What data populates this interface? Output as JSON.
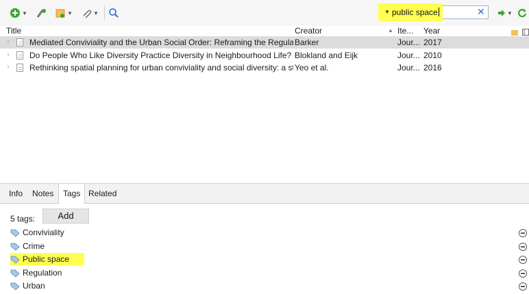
{
  "toolbar": {
    "icons": [
      "new-item-icon",
      "add-by-identifier-icon",
      "new-note-icon",
      "attach-icon",
      "advanced-search-icon",
      "locate-icon",
      "sync-icon"
    ],
    "colors": {
      "green": "#3aa53a",
      "orange": "#e8862a",
      "highlight": "#ffff52"
    }
  },
  "search": {
    "value": "public space",
    "clear_symbol": "✕"
  },
  "columns": {
    "title": "Title",
    "creator": "Creator",
    "item_type": "Ite...",
    "year": "Year"
  },
  "items": [
    {
      "title": "Mediated Conviviality and the Urban Social Order: Reframing the Regulation ...",
      "creator": "Barker",
      "type": "Jour...",
      "year": "2017"
    },
    {
      "title": "Do People Who Like Diversity Practice Diversity in Neighbourhood Life? Nei...",
      "creator": "Blokland and Eijk",
      "type": "Jour...",
      "year": "2010"
    },
    {
      "title": "Rethinking spatial planning for urban conviviality and social diversity: a study...",
      "creator": "Yeo et al.",
      "type": "Jour...",
      "year": "2016"
    }
  ],
  "tabs": [
    "Info",
    "Notes",
    "Tags",
    "Related"
  ],
  "active_tab": "Tags",
  "tags_panel": {
    "count_label": "5 tags:",
    "add_label": "Add",
    "tags": [
      "Conviviality",
      "Crime",
      "Public space",
      "Regulation",
      "Urban"
    ]
  }
}
